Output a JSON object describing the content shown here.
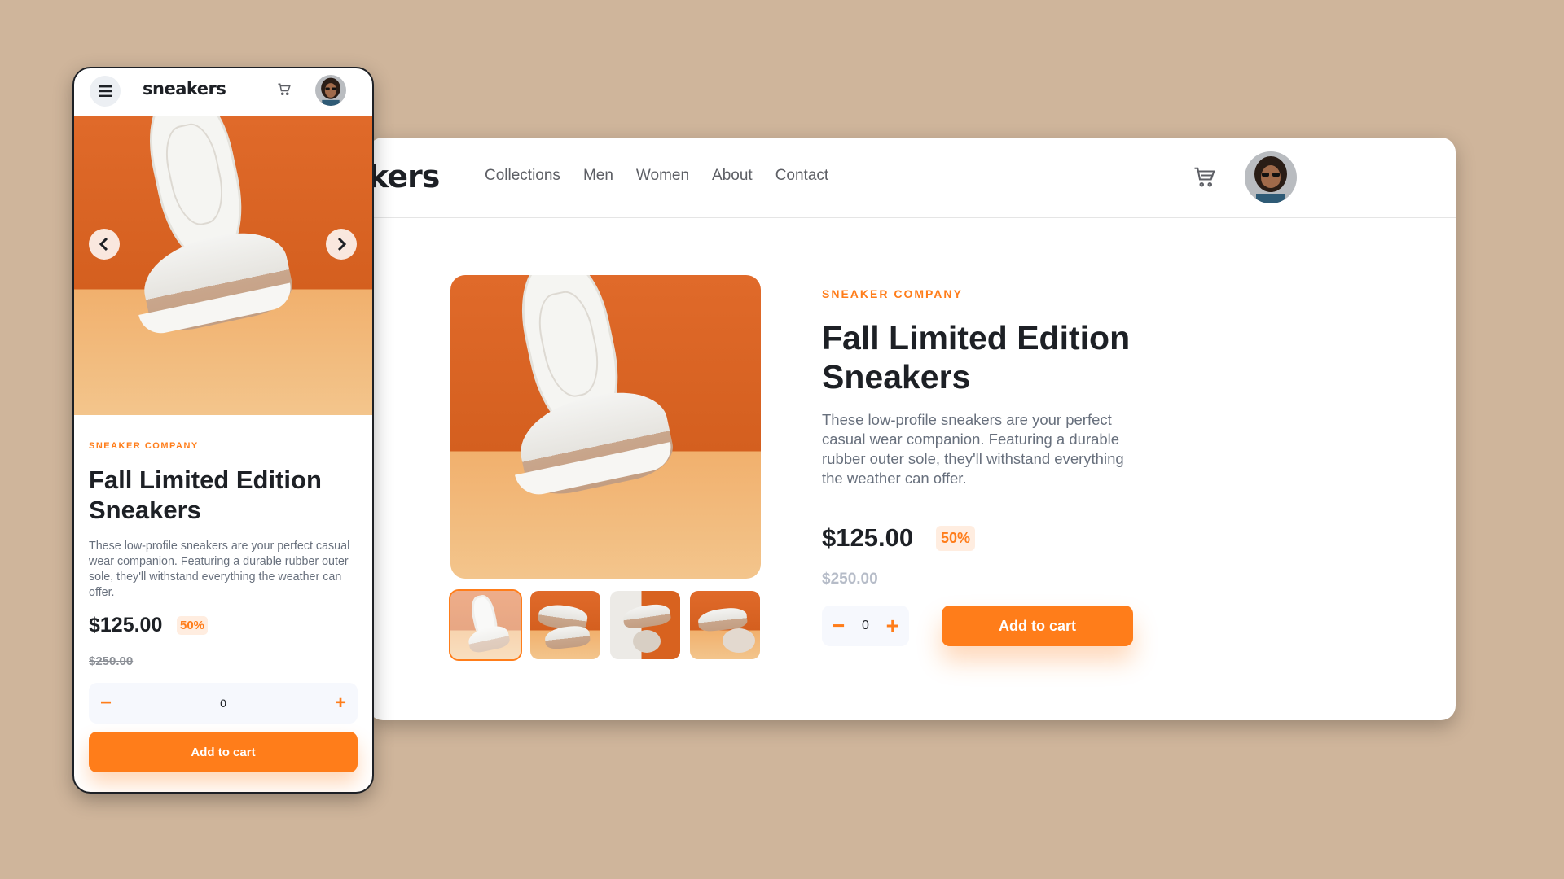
{
  "brand": "sneakers",
  "desktop_logo_partial": "kers",
  "nav": [
    "Collections",
    "Men",
    "Women",
    "About",
    "Contact"
  ],
  "product": {
    "company": "SNEAKER COMPANY",
    "title": "Fall Limited Edition Sneakers",
    "description_desktop": "These low-profile sneakers are your perfect casual wear companion. Featuring a durable rubber outer sole, they'll withstand everything the weather can offer.",
    "description_mobile": "These low-profile sneakers are your perfect casual wear companion. Featuring a durable rubber outer sole, they'll withstand everything the weather can offer.",
    "price": "$125.00",
    "discount": "50%",
    "old_price": "$250.00",
    "quantity": "0",
    "add_label": "Add to cart",
    "minus": "−",
    "plus": "+"
  },
  "colors": {
    "accent": "#ff7d1a",
    "background": "#cfb59b",
    "text_dark": "#1d2025",
    "text_gray": "#68707d"
  },
  "icons": {
    "cart": "cart-icon",
    "menu": "hamburger-icon",
    "prev": "chevron-left-icon",
    "next": "chevron-right-icon"
  }
}
